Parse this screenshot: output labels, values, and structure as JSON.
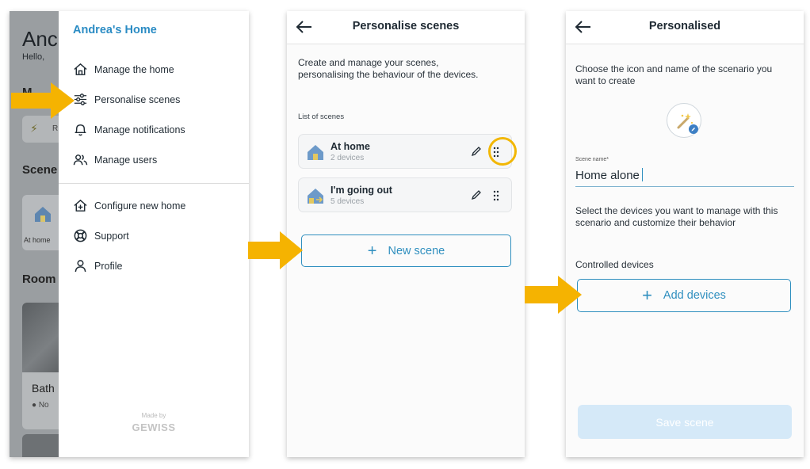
{
  "colors": {
    "accent": "#2f8fbf",
    "arrow": "#f5b301",
    "highlight_ring": "#f2b705",
    "save_disabled": "#d5e9f8"
  },
  "screen1": {
    "background_app": {
      "title": "Anc",
      "greeting": "Hello,",
      "section_letter": "M",
      "chip_text": "R",
      "scenes_heading": "Scene",
      "scene_card_caption": "At home",
      "rooms_heading": "Room",
      "room_name": "Bath",
      "room_status": "No"
    },
    "drawer": {
      "home_name": "Andrea's Home",
      "menu_top": [
        {
          "label": "Manage the home",
          "icon": "home-icon"
        },
        {
          "label": "Personalise scenes",
          "icon": "sliders-icon"
        },
        {
          "label": "Manage notifications",
          "icon": "bell-icon"
        },
        {
          "label": "Manage users",
          "icon": "users-icon"
        }
      ],
      "menu_bottom": [
        {
          "label": "Configure new home",
          "icon": "home-plus-icon"
        },
        {
          "label": "Support",
          "icon": "lifebuoy-icon"
        },
        {
          "label": "Profile",
          "icon": "person-icon"
        }
      ],
      "made_by": "Made by",
      "brand": "GEWISS"
    }
  },
  "screen2": {
    "title": "Personalise scenes",
    "intro": "Create and manage your scenes, personalising the behaviour of the devices.",
    "list_label": "List of scenes",
    "scenes": [
      {
        "name": "At home",
        "devices": "2 devices"
      },
      {
        "name": "I'm going out",
        "devices": "5 devices"
      }
    ],
    "new_scene_label": "New scene",
    "plus": "+"
  },
  "screen3": {
    "title": "Personalised",
    "intro": "Choose the icon and name of the scenario you want to create",
    "name_label": "Scene name*",
    "name_value": "Home alone",
    "devices_text": "Select the devices you want to manage with this scenario and customize their behavior",
    "controlled_label": "Controlled devices",
    "add_devices_label": "Add devices",
    "plus": "+",
    "save_label": "Save scene"
  }
}
